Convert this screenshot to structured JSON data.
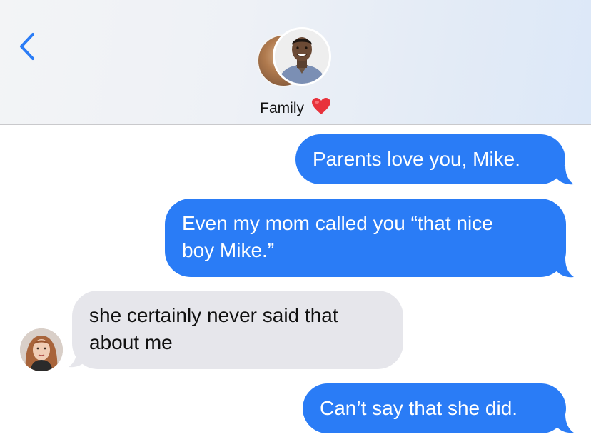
{
  "header": {
    "group_name": "Family",
    "back_icon": "chevron-left-icon",
    "heart_icon": "red-heart-emoji"
  },
  "colors": {
    "outgoing_bubble": "#2a7cf6",
    "incoming_bubble": "#e6e6eb",
    "accent": "#2a7cf6"
  },
  "messages": [
    {
      "direction": "outgoing",
      "text": "Parents love you, Mike."
    },
    {
      "direction": "outgoing",
      "line1": "Even my mom called you “that nice",
      "line2": "boy Mike.”"
    },
    {
      "direction": "incoming",
      "line1": "she certainly never said that",
      "line2": "about me"
    },
    {
      "direction": "outgoing",
      "text": "Can’t say that she did."
    }
  ]
}
